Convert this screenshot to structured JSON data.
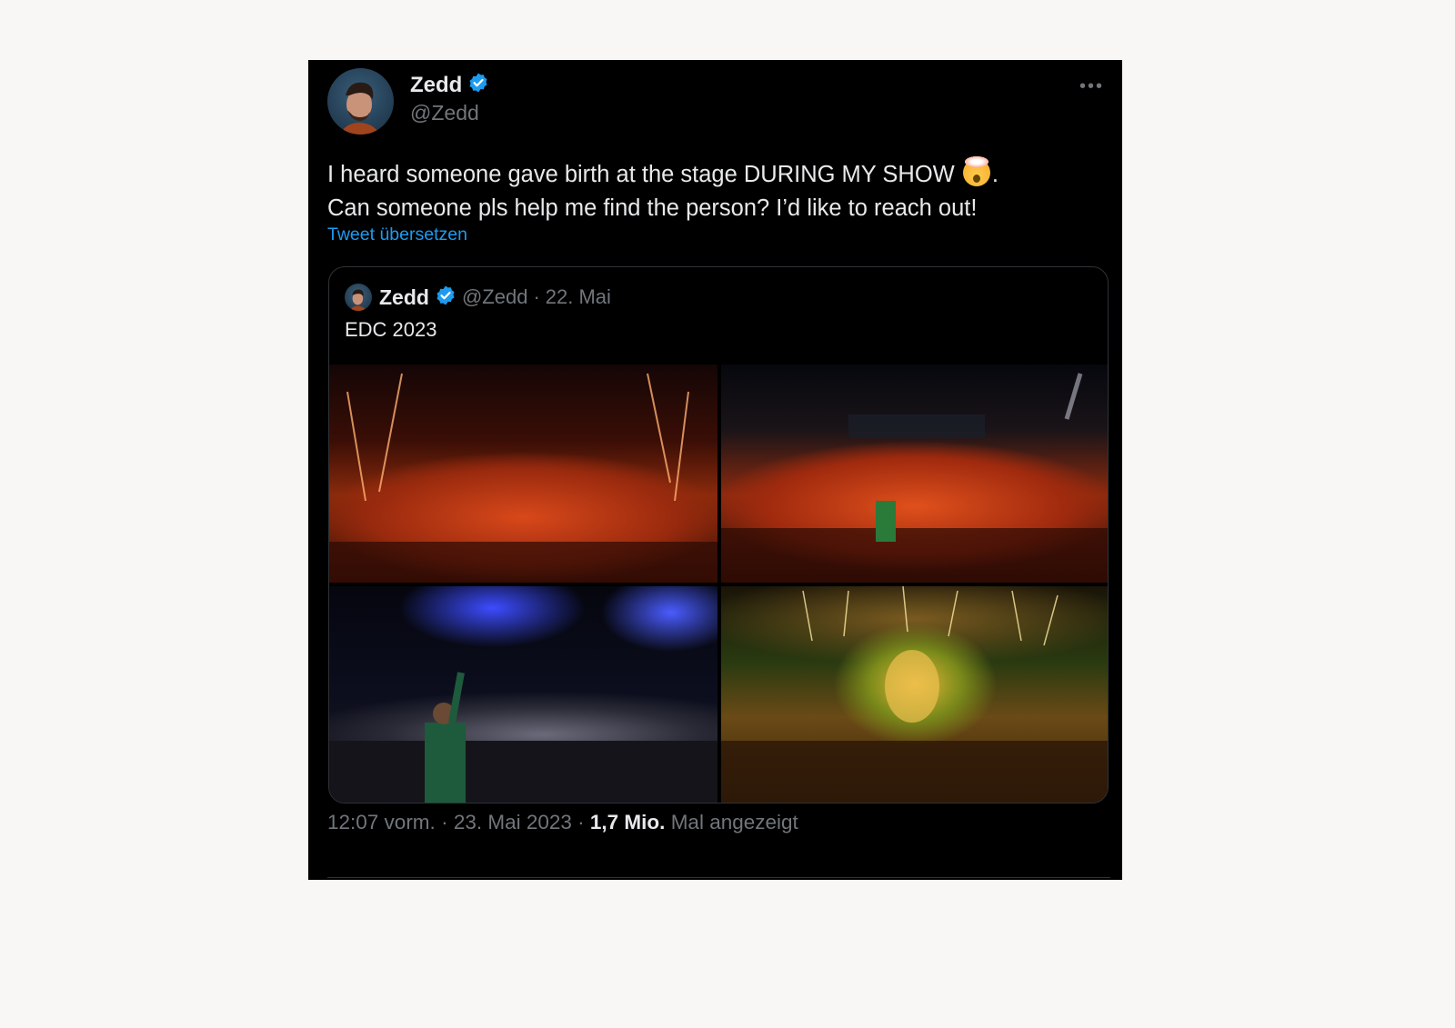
{
  "tweet": {
    "author": {
      "name": "Zedd",
      "handle": "@Zedd",
      "verified": true
    },
    "more_icon": "ellipsis-icon",
    "text_line1_before_emoji": "I heard someone gave birth at the stage DURING MY SHOW ",
    "emoji": "exploding-head-emoji",
    "text_line1_after_emoji": ".",
    "text_line2": "Can someone pls help me find the person? I’d like to reach out!",
    "translate_link": "Tweet übersetzen",
    "quoted": {
      "name": "Zedd",
      "handle": "@Zedd",
      "separator": "·",
      "date": "22. Mai",
      "text": "EDC 2023",
      "photos": [
        "edc-crowd-photo-1",
        "edc-stage-photo-2",
        "edc-dj-photo-3",
        "edc-fireworks-photo-4"
      ]
    },
    "footer": {
      "time": "12:07 vorm.",
      "sep1": " · ",
      "date": "23. Mai 2023",
      "sep2": " · ",
      "views_count": "1,7 Mio.",
      "views_label": " Mal angezeigt"
    }
  },
  "colors": {
    "background": "#000000",
    "text": "#e7e9ea",
    "muted": "#71767b",
    "link": "#1d9bf0",
    "verified_badge": "#1d9bf0"
  }
}
